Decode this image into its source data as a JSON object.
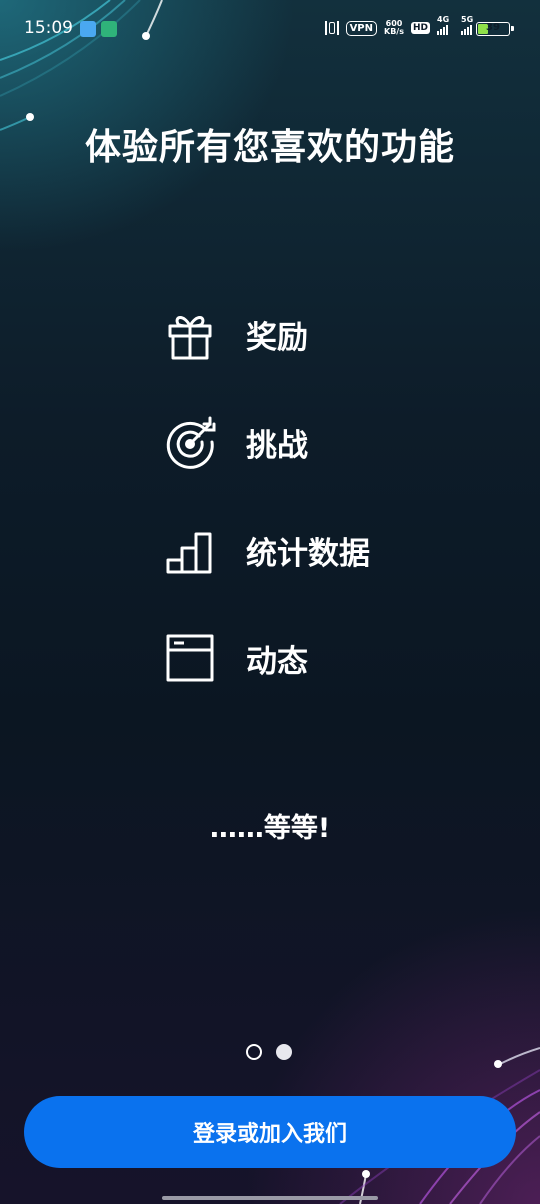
{
  "status_bar": {
    "time": "15:09",
    "vpn": "VPN",
    "speed_value": "600",
    "speed_unit": "KB/s",
    "hd": "HD",
    "network_1": "4G",
    "network_2": "5G",
    "battery_percent": 39
  },
  "headline": "体验所有您喜欢的功能",
  "features": [
    {
      "icon": "gift-icon",
      "label": "奖励"
    },
    {
      "icon": "target-icon",
      "label": "挑战"
    },
    {
      "icon": "bar-chart-icon",
      "label": "统计数据"
    },
    {
      "icon": "feed-window-icon",
      "label": "动态"
    }
  ],
  "more_text": "……等等!",
  "pagination": {
    "total": 2,
    "active_index": 1
  },
  "cta": {
    "label": "登录或加入我们"
  },
  "colors": {
    "cta_background": "#0a72ee",
    "battery_fill": "#8fe04a",
    "text": "#ffffff"
  }
}
